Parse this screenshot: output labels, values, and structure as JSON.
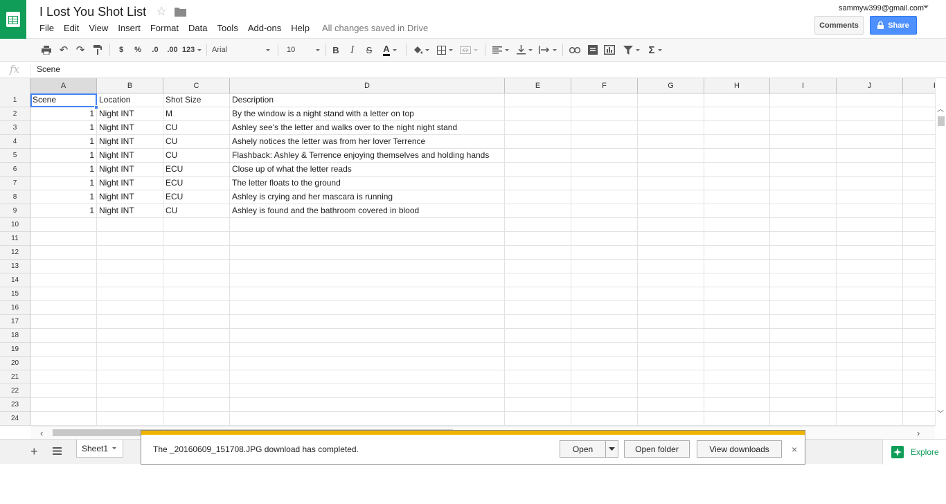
{
  "header": {
    "title": "I Lost You Shot List",
    "menu": [
      "File",
      "Edit",
      "View",
      "Insert",
      "Format",
      "Data",
      "Tools",
      "Add-ons",
      "Help"
    ],
    "save_status": "All changes saved in Drive",
    "account": "sammyw399@gmail.com",
    "comments_label": "Comments",
    "share_label": "Share"
  },
  "toolbar": {
    "currency": "$",
    "percent": "%",
    "dec_less": ".0",
    "dec_more": ".00",
    "more_formats": "123",
    "font": "Arial",
    "font_size": "10",
    "bold": "B",
    "italic": "I",
    "strike": "S",
    "text_color": "A",
    "sigma": "Σ"
  },
  "formula_bar": {
    "fx": "fx",
    "value": "Scene"
  },
  "columns": [
    "A",
    "B",
    "C",
    "D",
    "E",
    "F",
    "G",
    "H",
    "I",
    "J",
    "K"
  ],
  "row_numbers": [
    "1",
    "2",
    "3",
    "4",
    "5",
    "6",
    "7",
    "8",
    "9",
    "10",
    "11",
    "12",
    "13",
    "14",
    "15",
    "16",
    "17",
    "18",
    "19",
    "20",
    "21",
    "22",
    "23",
    "24"
  ],
  "rows": [
    [
      "Scene",
      "Location",
      "Shot Size",
      "Description"
    ],
    [
      "1",
      "Night INT",
      "M",
      "By the window is a night stand with a letter on top"
    ],
    [
      "1",
      "Night INT",
      "CU",
      "Ashley see's the letter and walks over to the night night stand"
    ],
    [
      "1",
      "Night INT",
      "CU",
      "Ashely notices the letter was from her lover Terrence"
    ],
    [
      "1",
      "Night INT",
      "CU",
      "Flashback: Ashley & Terrence enjoying themselves and holding hands"
    ],
    [
      "1",
      "Night INT",
      "ECU",
      "Close up of what the letter reads"
    ],
    [
      "1",
      "Night INT",
      "ECU",
      "The letter floats to the ground"
    ],
    [
      "1",
      "Night INT",
      "ECU",
      "Ashley is crying and her mascara is running"
    ],
    [
      "1",
      "Night INT",
      "CU",
      "Ashley is found and the bathroom covered in blood"
    ]
  ],
  "sheets": {
    "active": "Sheet1",
    "explore_label": "Explore"
  },
  "download": {
    "message": "The _20160609_151708.JPG download has completed.",
    "open_label": "Open",
    "open_folder_label": "Open folder",
    "view_downloads_label": "View downloads",
    "close": "×"
  },
  "colors": {
    "brand_green": "#0f9d58",
    "share_blue": "#4d90fe",
    "selection_blue": "#4285f4",
    "download_stripe": "#f0b400"
  }
}
